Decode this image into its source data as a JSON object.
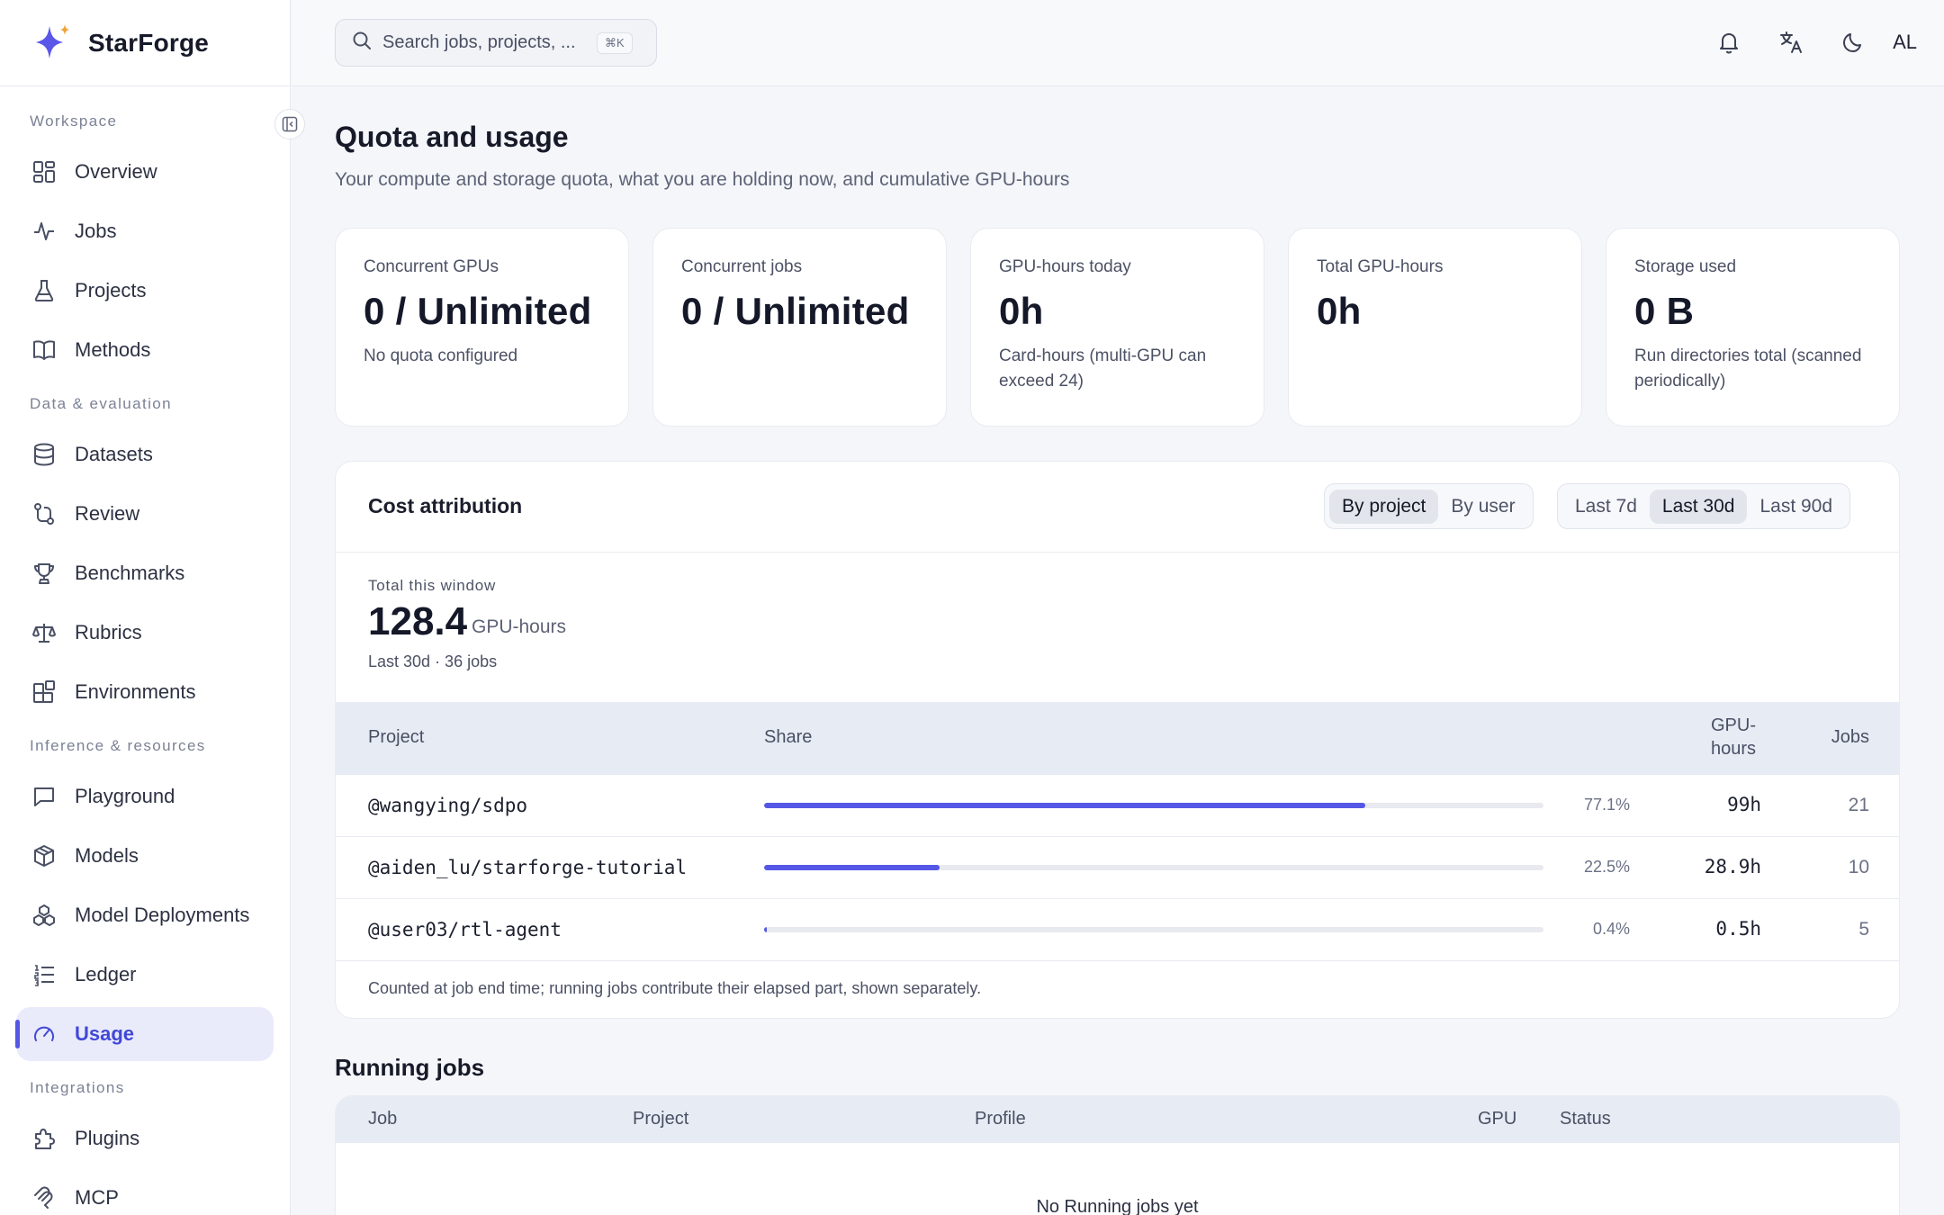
{
  "app": {
    "name": "StarForge"
  },
  "sidebar": {
    "sections": {
      "workspace": "Workspace",
      "data": "Data & evaluation",
      "inference": "Inference & resources",
      "integrations": "Integrations"
    },
    "items": [
      {
        "label": "Overview",
        "icon": "grid-icon"
      },
      {
        "label": "Jobs",
        "icon": "activity-icon"
      },
      {
        "label": "Projects",
        "icon": "flask-icon"
      },
      {
        "label": "Methods",
        "icon": "book-icon"
      },
      {
        "label": "Datasets",
        "icon": "database-icon"
      },
      {
        "label": "Review",
        "icon": "git-compare-icon"
      },
      {
        "label": "Benchmarks",
        "icon": "trophy-icon"
      },
      {
        "label": "Rubrics",
        "icon": "scale-icon"
      },
      {
        "label": "Environments",
        "icon": "blocks-icon"
      },
      {
        "label": "Playground",
        "icon": "message-icon"
      },
      {
        "label": "Models",
        "icon": "box-icon"
      },
      {
        "label": "Model Deployments",
        "icon": "cluster-icon"
      },
      {
        "label": "Ledger",
        "icon": "list-ordered-icon"
      },
      {
        "label": "Usage",
        "icon": "gauge-icon",
        "active": true
      },
      {
        "label": "Plugins",
        "icon": "puzzle-icon"
      },
      {
        "label": "MCP",
        "icon": "mcp-icon"
      }
    ]
  },
  "topbar": {
    "search_placeholder": "Search jobs, projects, ...",
    "search_shortcut": "⌘K",
    "avatar": "AL"
  },
  "page": {
    "title": "Quota and usage",
    "subtitle": "Your compute and storage quota, what you are holding now, and cumulative GPU-hours"
  },
  "stats": [
    {
      "key": "Concurrent GPUs",
      "value": "0 / Unlimited",
      "note": "No quota configured"
    },
    {
      "key": "Concurrent jobs",
      "value": "0 / Unlimited",
      "note": ""
    },
    {
      "key": "GPU-hours today",
      "value": "0h",
      "note": "Card-hours (multi-GPU can exceed 24)"
    },
    {
      "key": "Total GPU-hours",
      "value": "0h",
      "note": ""
    },
    {
      "key": "Storage used",
      "value": "0 B",
      "note": "Run directories total (scanned periodically)"
    }
  ],
  "cost": {
    "title": "Cost attribution",
    "group_by": {
      "options": [
        "By project",
        "By user"
      ],
      "selected": "By project"
    },
    "window": {
      "options": [
        "Last 7d",
        "Last 30d",
        "Last 90d"
      ],
      "selected": "Last 30d"
    },
    "total_label": "Total this window",
    "total_value": "128.4",
    "total_unit": "GPU-hours",
    "total_meta": "Last 30d · 36 jobs",
    "columns": {
      "project": "Project",
      "share": "Share",
      "gpu_hours": "GPU-\nhours",
      "jobs": "Jobs"
    },
    "rows": [
      {
        "project": "@wangying/sdpo",
        "share": 0.771,
        "share_text": "77.1%",
        "gpu_hours": "99h",
        "jobs": "21"
      },
      {
        "project": "@aiden_lu/starforge-tutorial",
        "share": 0.225,
        "share_text": "22.5%",
        "gpu_hours": "28.9h",
        "jobs": "10"
      },
      {
        "project": "@user03/rtl-agent",
        "share": 0.004,
        "share_text": "0.4%",
        "gpu_hours": "0.5h",
        "jobs": "5"
      }
    ],
    "footnote": "Counted at job end time; running jobs contribute their elapsed part, shown separately."
  },
  "running": {
    "title": "Running jobs",
    "columns": {
      "job": "Job",
      "project": "Project",
      "profile": "Profile",
      "gpu": "GPU",
      "status": "Status"
    },
    "empty": "No Running jobs yet"
  },
  "colors": {
    "accent": "#5457e6",
    "bar_track": "#e8eaef",
    "header_band": "#e7ebf4"
  }
}
